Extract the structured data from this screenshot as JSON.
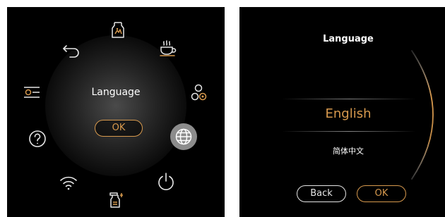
{
  "main_menu": {
    "center_label": "Language",
    "ok_label": "OK",
    "icons": [
      "bean-hopper-icon",
      "coffee-cup-icon",
      "settings-icon",
      "power-icon",
      "cleaning-icon",
      "wifi-icon",
      "help-icon",
      "recipe-settings-icon",
      "back-icon",
      "language-icon"
    ],
    "selected": "language-icon"
  },
  "language_screen": {
    "title": "Language",
    "selected_option": "English",
    "other_option": "简体中文",
    "back_label": "Back",
    "ok_label": "OK"
  },
  "colors": {
    "accent": "#d89a4e",
    "background": "#000000",
    "text": "#ffffff",
    "selected_bg": "#8c8c8c"
  }
}
